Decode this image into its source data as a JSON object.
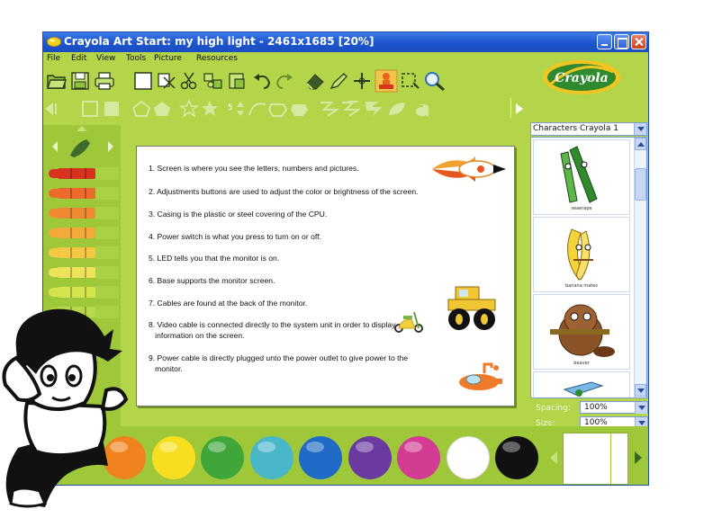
{
  "window": {
    "title": "Crayola Art Start: my high light - 2461x1685 [20%]"
  },
  "menu": [
    "File",
    "Edit",
    "View",
    "Tools",
    "Picture",
    "Resources"
  ],
  "brand": {
    "logo_text": "Crayola",
    "accent": "#b4d44a",
    "titlebar": "#1e56cf"
  },
  "toolbar": {
    "tools": [
      "open-icon",
      "save-icon",
      "print-icon",
      "new-page-icon",
      "clear-icon",
      "cut-icon",
      "copy-icon",
      "paste-icon",
      "undo-icon",
      "redo-icon",
      "eraser-icon",
      "marker-icon",
      "crosshair-icon",
      "stamp-icon",
      "select-icon",
      "magnifier-icon"
    ],
    "shape_size_value": "5"
  },
  "canvas": {
    "lines": [
      "1.  Screen is where you see the letters, numbers and pictures.",
      "2. Adjustments buttons are used to adjust the color or brightness of the screen.",
      "3. Casing is the plastic or steel covering of the CPU.",
      "4. Power switch is what you press to turn on or off.",
      "5. LED tells you that the monitor is on.",
      "6. Base supports the monitor screen.",
      "7. Cables are found at the back of the monitor.",
      "8. Video cable is connected directly to the system unit in order to display",
      "   information on the screen.",
      "9. Power cable is directly plugged unto the power outlet to give power to the",
      "   monitor."
    ]
  },
  "characters": {
    "selected_set": "Characters Crayola 1",
    "items": [
      "seaerape",
      "banana mates",
      "beaver"
    ]
  },
  "properties": {
    "spacing_label": "Spacing:",
    "spacing_value": "100%",
    "size_label": "Size:",
    "size_value": "100%"
  },
  "crayons": [
    "#d8331f",
    "#ec6a2a",
    "#f08a32",
    "#f4a93a",
    "#f5c843",
    "#eee25a",
    "#d5e34c",
    "#b7d84a"
  ],
  "palette_colors": [
    "#f0831e",
    "#f7df1f",
    "#3fa63a",
    "#4ab7c9",
    "#1f6bc6",
    "#6b3aa0",
    "#d23d93",
    "#ffffff",
    "#111111"
  ]
}
